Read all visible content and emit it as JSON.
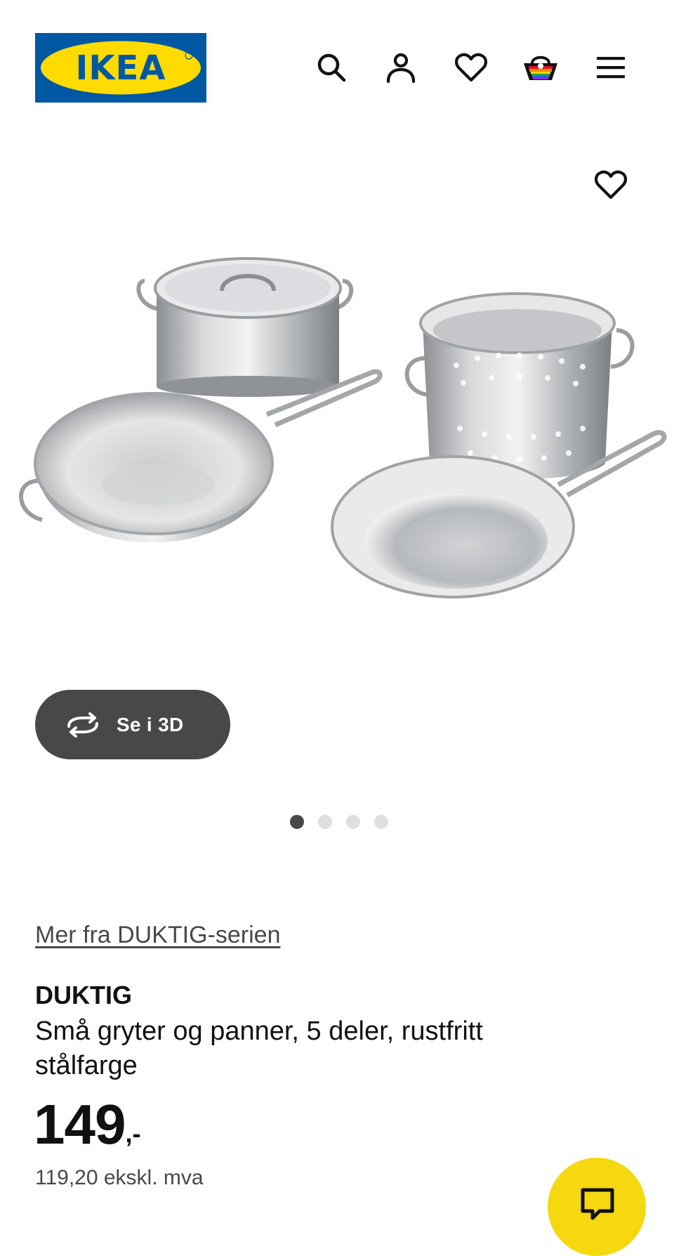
{
  "header": {
    "logo_text": "IKEA",
    "icons": [
      "search-icon",
      "account-icon",
      "favorites-icon",
      "basket-icon",
      "menu-icon"
    ]
  },
  "product_image": {
    "alt": "DUKTIG pots and pans"
  },
  "view_3d": {
    "label": "Se i 3D",
    "icon": "rotate-3d-icon"
  },
  "carousel": {
    "count": 4,
    "active_index": 0
  },
  "product": {
    "series_link": "Mer fra DUKTIG-serien",
    "name": "DUKTIG",
    "description": "Små gryter og panner, 5 deler, rustfritt stålfarge",
    "price_whole": "149",
    "price_suffix": ",-",
    "price_ex_vat": "119,20 ekskl. mva"
  },
  "colors": {
    "ikea_blue": "#0058a3",
    "ikea_yellow": "#ffdb00",
    "chat_yellow": "#f5d80f",
    "dark_button": "#484848"
  }
}
